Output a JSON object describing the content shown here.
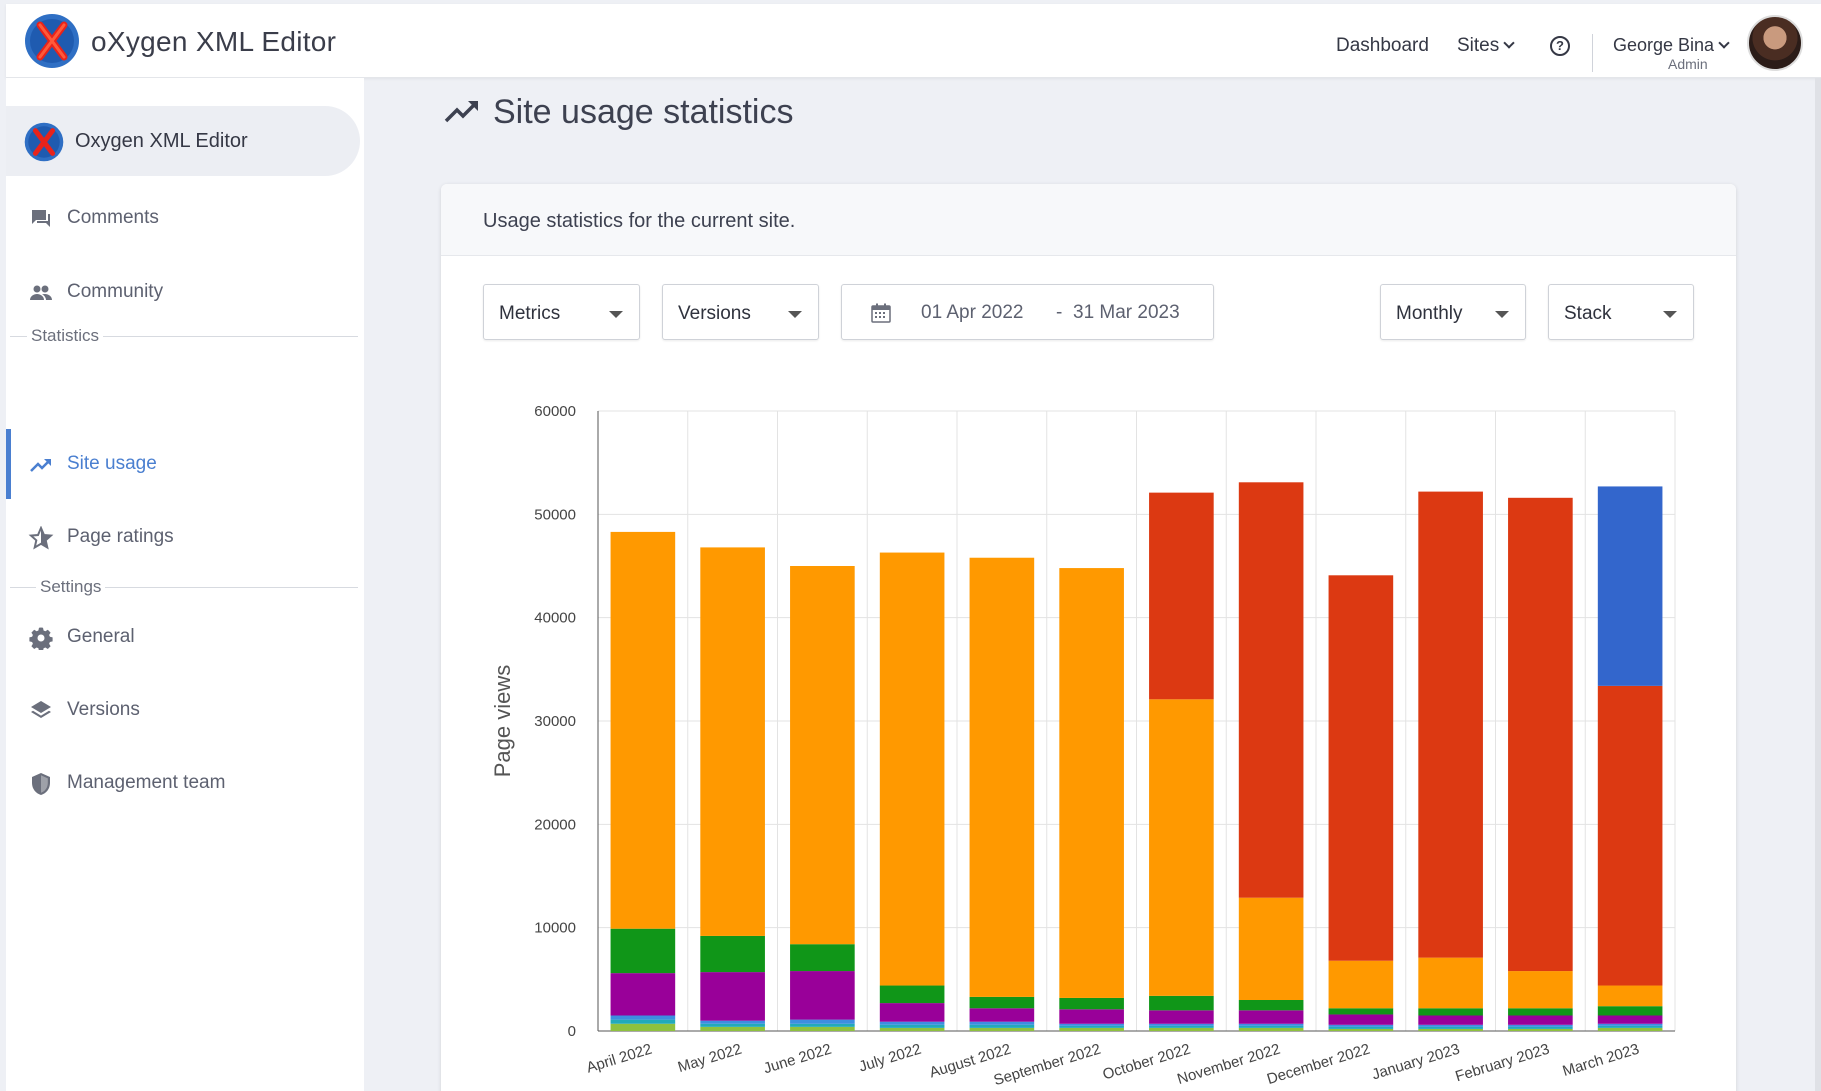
{
  "header": {
    "app_title": "oXygen XML Editor",
    "nav": {
      "dashboard": "Dashboard",
      "sites": "Sites"
    },
    "help_icon": "help-circle-icon",
    "user": {
      "name": "George Bina",
      "role": "Admin"
    }
  },
  "sidebar": {
    "site_name": "Oxygen XML Editor",
    "items_top": [
      {
        "label": "Comments",
        "icon": "comments-icon"
      },
      {
        "label": "Community",
        "icon": "community-icon"
      }
    ],
    "section_statistics": "Statistics",
    "items_statistics": [
      {
        "label": "Site usage",
        "icon": "trending-up-icon",
        "active": true
      },
      {
        "label": "Page ratings",
        "icon": "star-icon"
      }
    ],
    "section_settings": "Settings",
    "items_settings": [
      {
        "label": "General",
        "icon": "gear-icon"
      },
      {
        "label": "Versions",
        "icon": "layers-icon"
      },
      {
        "label": "Management team",
        "icon": "shield-icon"
      }
    ]
  },
  "main": {
    "title": "Site usage statistics",
    "description": "Usage statistics for the current site.",
    "filters": {
      "metrics": "Metrics",
      "versions": "Versions",
      "date_from": "01 Apr 2022",
      "date_sep": "-",
      "date_to": "31 Mar 2023",
      "interval": "Monthly",
      "mode": "Stack"
    }
  },
  "colors": {
    "accent": "#4a7fd0",
    "lightgreen": "#8fc13f",
    "teal": "#22aabb",
    "blue_small": "#3d8ee0",
    "purple": "#990099",
    "green": "#109618",
    "orange": "#ff9900",
    "red": "#dc3912",
    "blue": "#3366cc"
  },
  "chart_data": {
    "type": "bar",
    "stacked": true,
    "ylabel": "Page views",
    "ylim": [
      0,
      60000
    ],
    "yticks": [
      0,
      10000,
      20000,
      30000,
      40000,
      50000,
      60000
    ],
    "grid": true,
    "categories": [
      "April 2022",
      "May 2022",
      "June 2022",
      "July 2022",
      "August 2022",
      "September 2022",
      "October 2022",
      "November 2022",
      "December 2022",
      "January 2023",
      "February 2023",
      "March 2023"
    ],
    "series": [
      {
        "color": "#8fc13f",
        "values": [
          700,
          400,
          400,
          300,
          300,
          300,
          300,
          300,
          200,
          200,
          200,
          300
        ]
      },
      {
        "color": "#22aabb",
        "values": [
          400,
          300,
          300,
          300,
          300,
          200,
          200,
          200,
          200,
          200,
          200,
          200
        ]
      },
      {
        "color": "#3d8ee0",
        "values": [
          400,
          300,
          400,
          300,
          300,
          200,
          200,
          200,
          200,
          200,
          200,
          200
        ]
      },
      {
        "color": "#990099",
        "values": [
          4100,
          4700,
          4700,
          1800,
          1300,
          1400,
          1300,
          1300,
          1000,
          900,
          900,
          800
        ]
      },
      {
        "color": "#109618",
        "values": [
          4300,
          3500,
          2600,
          1700,
          1100,
          1100,
          1400,
          1000,
          600,
          700,
          700,
          900
        ]
      },
      {
        "color": "#ff9900",
        "values": [
          38400,
          37600,
          36600,
          41900,
          42500,
          41600,
          28700,
          9900,
          4600,
          4900,
          3600,
          2000
        ]
      },
      {
        "color": "#dc3912",
        "values": [
          0,
          0,
          0,
          0,
          0,
          0,
          20000,
          40200,
          37300,
          45100,
          45800,
          29000
        ]
      },
      {
        "color": "#3366cc",
        "values": [
          0,
          0,
          0,
          0,
          0,
          0,
          0,
          0,
          0,
          0,
          0,
          19300
        ]
      }
    ]
  }
}
